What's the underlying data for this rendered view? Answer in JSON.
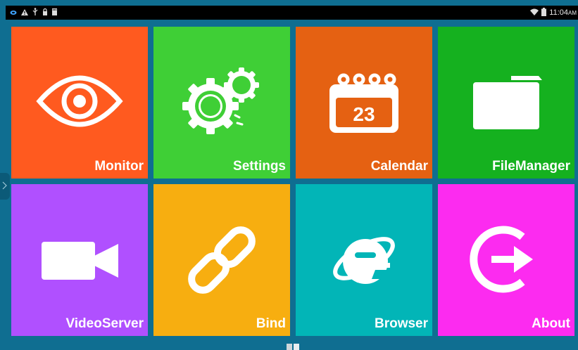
{
  "status_bar": {
    "left_icons": [
      "notification-icon",
      "warning-icon",
      "usb-icon",
      "lock-icon",
      "sd-card-icon"
    ],
    "right_icons": [
      "wifi-icon",
      "battery-icon"
    ],
    "time": "11:04",
    "ampm": "AM"
  },
  "tiles": [
    {
      "label": "Monitor",
      "color": "#ff5a1f",
      "icon": "eye-icon"
    },
    {
      "label": "Settings",
      "color": "#3fcf36",
      "icon": "gears-icon"
    },
    {
      "label": "Calendar",
      "color": "#e56112",
      "icon": "calendar-icon",
      "icon_text": "23"
    },
    {
      "label": "FileManager",
      "color": "#15b11f",
      "icon": "folder-icon"
    },
    {
      "label": "VideoServer",
      "color": "#b050ff",
      "icon": "video-camera-icon"
    },
    {
      "label": "Bind",
      "color": "#f7ae10",
      "icon": "link-icon"
    },
    {
      "label": "Browser",
      "color": "#02b5b7",
      "icon": "browser-e-icon"
    },
    {
      "label": "About",
      "color": "#fc2bf0",
      "icon": "exit-arrow-icon"
    }
  ],
  "colors": {
    "background": "#0f6e91",
    "status_bar": "#000000"
  }
}
